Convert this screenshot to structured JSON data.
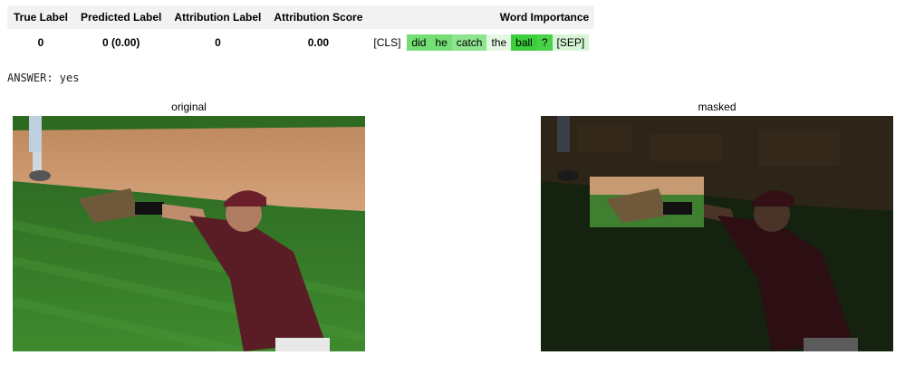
{
  "table": {
    "headers": {
      "true_label": "True Label",
      "predicted_label": "Predicted Label",
      "attribution_label": "Attribution Label",
      "attribution_score": "Attribution Score",
      "word_importance": "Word Importance"
    },
    "row": {
      "true_label": "0",
      "predicted_label": "0 (0.00)",
      "attribution_label": "0",
      "attribution_score": "0.00"
    },
    "tokens": [
      {
        "text": "[CLS]",
        "color": "#ffffff"
      },
      {
        "text": "did",
        "color": "#74de74"
      },
      {
        "text": "he",
        "color": "#74de74"
      },
      {
        "text": "catch",
        "color": "#8fe48f"
      },
      {
        "text": "the",
        "color": "#e3f8e3"
      },
      {
        "text": "ball",
        "color": "#3dce3d"
      },
      {
        "text": "?",
        "color": "#49d249"
      },
      {
        "text": "[SEP]",
        "color": "#d6f5d6"
      }
    ]
  },
  "answer_text": "ANSWER: yes",
  "figures": {
    "original_title": "original",
    "masked_title": "masked"
  }
}
